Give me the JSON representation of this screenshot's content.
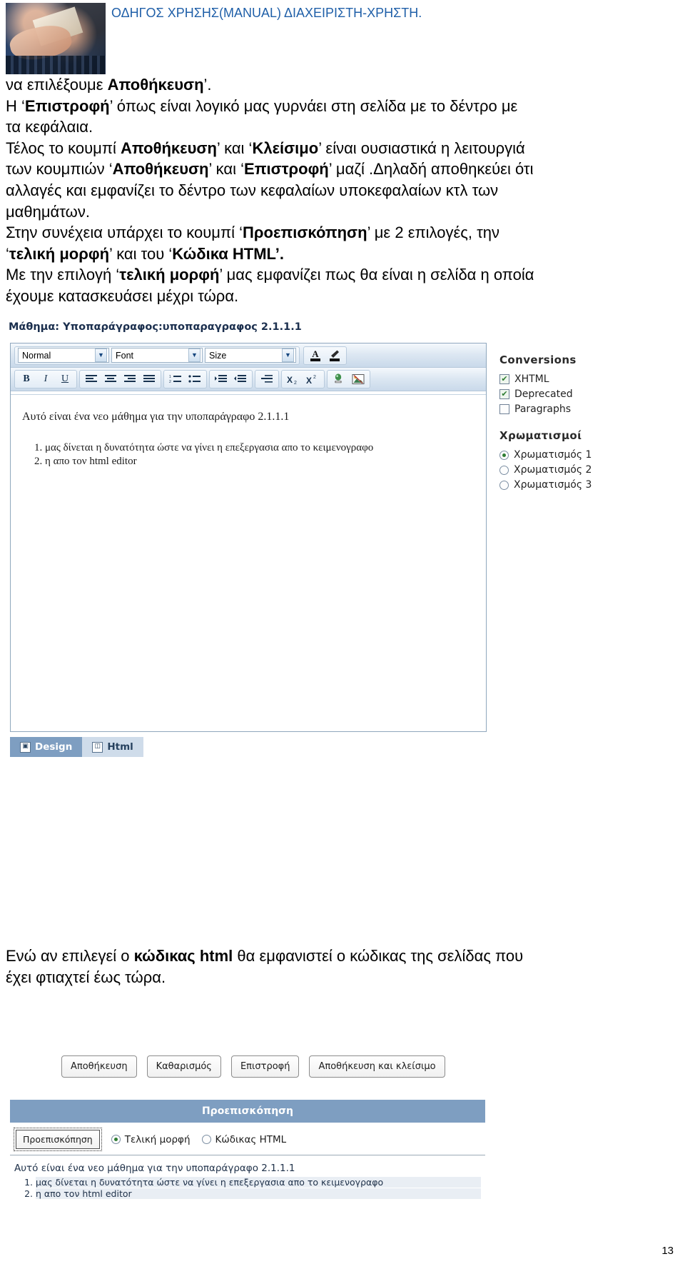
{
  "header": {
    "title": "ΟΔΗΓΟΣ ΧΡΗΣΗΣ(MANUAL) ΔΙΑΧΕΙΡΙΣΤΗ-ΧΡΗΣΤΗ.",
    "title_color": "#1f5fa8",
    "photo_alt": "hands-on-keyboard-photo"
  },
  "prose_top": {
    "l1_a": "να επιλέξουμε ",
    "l1_b": "Αποθήκευση",
    "l1_c": "’.",
    "l2_a": "Η ‘",
    "l2_b": "Επιστροφή",
    "l2_c": "’ όπως είναι λογικό μας   γυρνάει στη σελίδα με το δέντρο με",
    "l3": "τα κεφάλαια.",
    "l4_a": "Τέλος το κουμπί ",
    "l4_b": "Αποθήκευση",
    "l4_c": "’   και ‘",
    "l4_d": "Κλείσιμο",
    "l4_e": "’ είναι ουσιαστικά η λειτουργιά",
    "l5_a": "των κουμπιών ‘",
    "l5_b": "Αποθήκευση",
    "l5_c": "’ και ‘",
    "l5_d": "Επιστροφή",
    "l5_e": "’ μαζί .Δηλαδή αποθηκεύει ότι",
    "l6": "αλλαγές και εμφανίζει το δέντρο των κεφαλαίων υποκεφαλαίων κτλ των",
    "l7": "μαθημάτων.",
    "l8_a": "Στην συνέχεια υπάρχει το κουμπί  ‘",
    "l8_b": "Προεπισκόπηση",
    "l8_c": "’ με 2   επιλογές, την",
    "l9_a": "‘",
    "l9_b": "τελική μορφή",
    "l9_c": "’ και του ‘",
    "l9_d": "Κώδικα HTML’.",
    "l10_a": "Με την επιλογή ‘",
    "l10_b": "τελική μορφή",
    "l10_c": "’ μας εμφανίζει πως θα είναι η σελίδα η οποία",
    "l11": "έχουμε κατασκευάσει μέχρι τώρα."
  },
  "screenshot": {
    "lesson_title": "Μάθημα: Υποπαράγραφος:υποπαραγραφος 2.1.1.1",
    "toolbar": {
      "format_select": "Normal",
      "font_select": "Font",
      "size_select": "Size",
      "caret_glyph": "▼",
      "buttons_row1": [
        {
          "name": "font-color-icon",
          "glyph": "A"
        },
        {
          "name": "highlight-color-icon",
          "glyph": "✎"
        }
      ],
      "buttons_row2": [
        {
          "name": "bold-button",
          "glyph": "B"
        },
        {
          "name": "italic-button",
          "glyph": "I"
        },
        {
          "name": "underline-button",
          "glyph": "U"
        },
        {
          "name": "align-left-button",
          "glyph": "≡"
        },
        {
          "name": "align-center-button",
          "glyph": "≡"
        },
        {
          "name": "align-right-button",
          "glyph": "≡"
        },
        {
          "name": "align-justify-button",
          "glyph": "≡"
        },
        {
          "name": "ordered-list-button",
          "glyph": "⒈≡"
        },
        {
          "name": "unordered-list-button",
          "glyph": "•≡"
        },
        {
          "name": "indent-button",
          "glyph": "⇥"
        },
        {
          "name": "outdent-button",
          "glyph": "⇤"
        },
        {
          "name": "horizontal-rule-button",
          "glyph": "≣"
        },
        {
          "name": "subscript-button",
          "glyph": "X₂"
        },
        {
          "name": "superscript-button",
          "glyph": "X²"
        },
        {
          "name": "insert-link-button",
          "glyph": "🔗"
        },
        {
          "name": "insert-image-button",
          "glyph": "🖼"
        }
      ]
    },
    "content": {
      "paragraph": "Αυτό είναι ένα νεο μάθημα για την υποπαράγραφο 2.1.1.1",
      "list": [
        "μας δίνεται η δυνατότητα  ώστε να γίνει η επεξεργασια απο το κειμενογραφο",
        "η απο τον html editor"
      ]
    },
    "tabs": [
      {
        "label": "Design",
        "icon": "design-icon",
        "glyph": "▣",
        "active": true
      },
      {
        "label": "Html",
        "icon": "html-icon",
        "glyph": "◫",
        "active": false
      }
    ],
    "action_buttons": [
      "Αποθήκευση",
      "Καθαρισμός",
      "Επιστροφή",
      "Αποθήκευση και κλείσιμο"
    ],
    "options": {
      "conversions_heading": "Conversions",
      "conversions": [
        {
          "label": "XHTML",
          "checked": true
        },
        {
          "label": "Deprecated",
          "checked": true
        },
        {
          "label": "Paragraphs",
          "checked": false
        }
      ],
      "colors_heading": "Χρωματισμοί",
      "colors": [
        {
          "label": "Χρωματισμός 1",
          "selected": true
        },
        {
          "label": "Χρωματισμός 2",
          "selected": false
        },
        {
          "label": "Χρωματισμός 3",
          "selected": false
        }
      ],
      "check_glyph": "✔"
    },
    "preview": {
      "bar_title": "Προεπισκόπηση",
      "button_label": "Προεπισκόπηση",
      "radios": [
        {
          "label": "Τελική μορφή",
          "selected": true
        },
        {
          "label": "Κώδικας HTML",
          "selected": false
        }
      ],
      "paragraph": "Αυτό είναι ένα νεο μάθημα για την υποπαράγραφο 2.1.1.1",
      "list": [
        "μας δίνεται η δυνατότητα  ώστε να γίνει η επεξεργασια απο το κειμενογραφο",
        "η απο τον html editor"
      ]
    }
  },
  "prose_bottom": {
    "l1_a": "Ενώ αν επιλεγεί ο ",
    "l1_b": "κώδικας  html",
    "l1_c": " θα εμφανιστεί ο κώδικας της σελίδας  που",
    "l2": "έχει φτιαχτεί έως τώρα."
  },
  "footer": {
    "page_number": "13"
  }
}
